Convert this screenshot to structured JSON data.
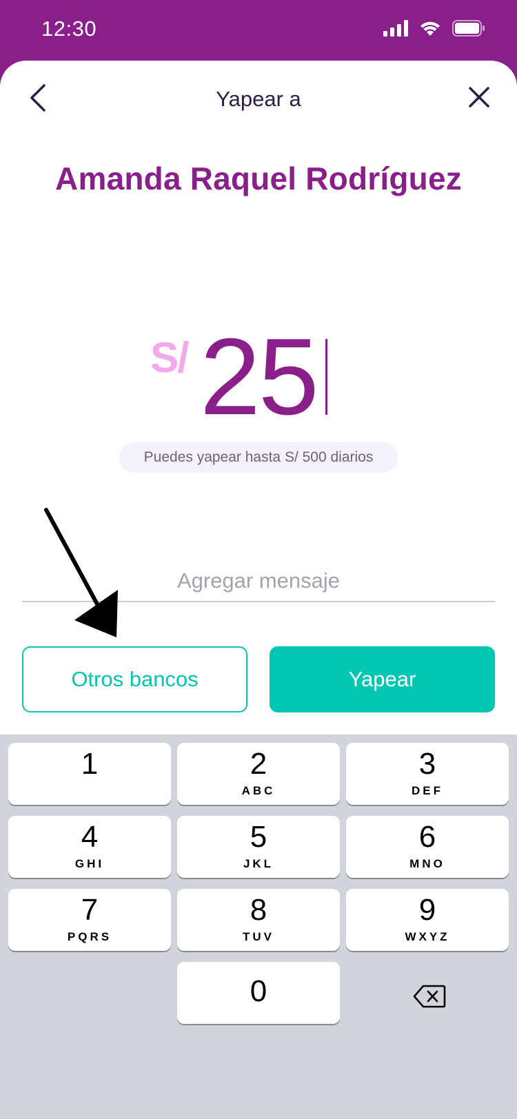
{
  "status_bar": {
    "time": "12:30"
  },
  "header": {
    "title": "Yapear a"
  },
  "recipient": {
    "name": "Amanda Raquel Rodríguez"
  },
  "amount": {
    "currency": "S/",
    "value": "25"
  },
  "limit_text": "Puedes yapear hasta S/ 500 diarios",
  "message": {
    "placeholder": "Agregar mensaje",
    "value": ""
  },
  "buttons": {
    "other_banks": "Otros bancos",
    "send": "Yapear"
  },
  "keypad": {
    "keys": [
      {
        "digit": "1",
        "letters": ""
      },
      {
        "digit": "2",
        "letters": "ABC"
      },
      {
        "digit": "3",
        "letters": "DEF"
      },
      {
        "digit": "4",
        "letters": "GHI"
      },
      {
        "digit": "5",
        "letters": "JKL"
      },
      {
        "digit": "6",
        "letters": "MNO"
      },
      {
        "digit": "7",
        "letters": "PQRS"
      },
      {
        "digit": "8",
        "letters": "TUV"
      },
      {
        "digit": "9",
        "letters": "WXYZ"
      },
      {
        "digit": "0",
        "letters": ""
      }
    ]
  },
  "colors": {
    "brand_purple": "#8a1f8c",
    "accent_teal": "#00c7b1",
    "currency_pink": "#f3a9ea"
  },
  "icons": {
    "back": "chevron-left-icon",
    "close": "close-icon",
    "backspace": "backspace-icon"
  }
}
